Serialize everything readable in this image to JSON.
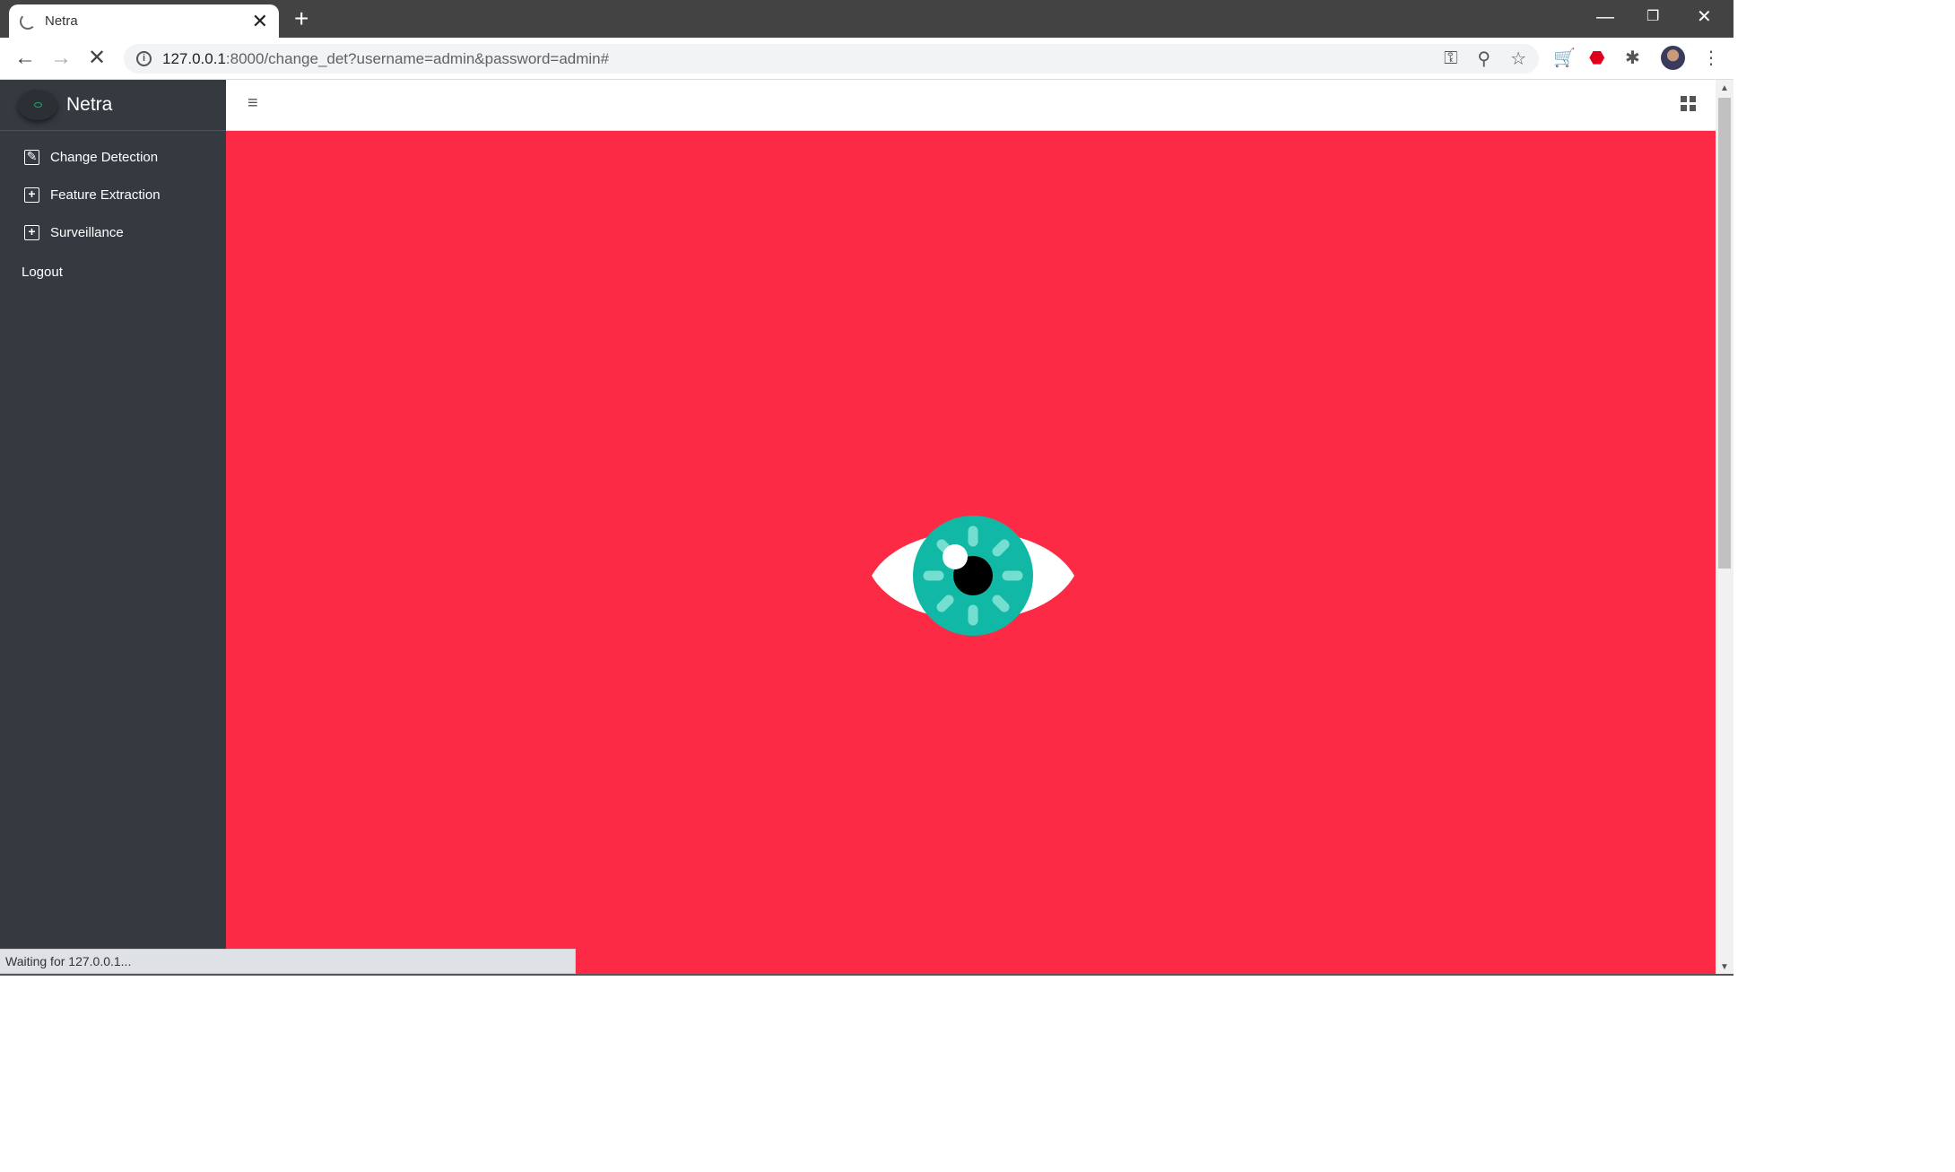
{
  "browser": {
    "tab_title": "Netra",
    "url_host": "127.0.0.1",
    "url_path": ":8000/change_det?username=admin&password=admin#",
    "status_text": "Waiting for 127.0.0.1..."
  },
  "app": {
    "brand_name": "Netra",
    "sidebar": {
      "items": [
        {
          "label": "Change Detection",
          "icon": "edit-icon"
        },
        {
          "label": "Feature Extraction",
          "icon": "plus-square-icon"
        },
        {
          "label": "Surveillance",
          "icon": "plus-square-icon"
        }
      ],
      "logout_label": "Logout"
    },
    "preloader_color": "#fd2a45"
  }
}
